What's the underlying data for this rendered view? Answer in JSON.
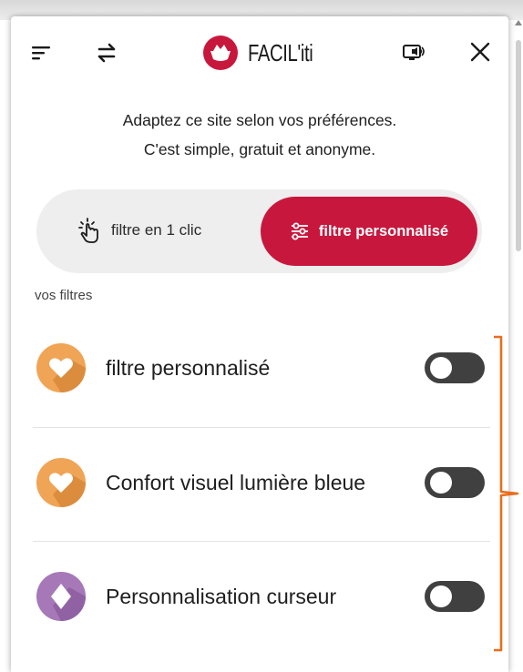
{
  "header": {
    "brand": "FACIL'iti",
    "icons": [
      "menu-icon",
      "swap-icon",
      "screen-reader-icon",
      "close-icon"
    ]
  },
  "intro": {
    "line1": "Adaptez ce site selon vos préférences.",
    "line2": "C'est simple, gratuit et anonyme."
  },
  "mode_switch": {
    "option_one_label": "filtre en 1 clic",
    "option_two_label": "filtre personnalisé",
    "selected": "filtre personnalisé"
  },
  "filters": {
    "section_label": "vos filtres",
    "items": [
      {
        "label": "filtre personnalisé",
        "icon": "heart-icon",
        "enabled": false
      },
      {
        "label": "Confort visuel lumière bleue",
        "icon": "heart-icon",
        "enabled": false
      },
      {
        "label": "Personnalisation curseur",
        "icon": "diamond-icon",
        "enabled": false
      }
    ]
  },
  "colors": {
    "accent_red": "#c8173d",
    "badge_orange": "#f0a455",
    "badge_purple": "#a678b8",
    "bracket_orange": "#e86e1c",
    "toggle_off": "#404040"
  }
}
